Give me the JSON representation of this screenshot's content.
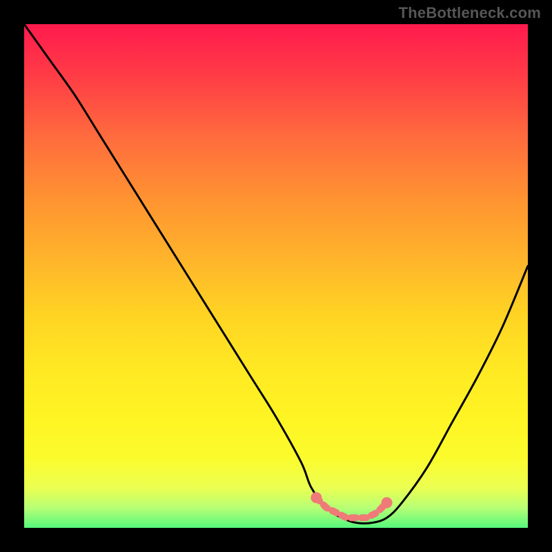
{
  "attribution": "TheBottleneck.com",
  "colors": {
    "background": "#000000",
    "attribution_text": "#565656",
    "curve": "#000000",
    "marker": "#ef7a78",
    "gradient_top": "#ff1a4d",
    "gradient_bottom": "#56f77c"
  },
  "chart_data": {
    "type": "line",
    "title": "",
    "xlabel": "",
    "ylabel": "",
    "xlim": [
      0,
      100
    ],
    "ylim": [
      0,
      100
    ],
    "x": [
      0,
      5,
      10,
      15,
      20,
      25,
      30,
      35,
      40,
      45,
      50,
      55,
      57,
      60,
      63,
      66,
      69,
      72,
      75,
      80,
      85,
      90,
      95,
      100
    ],
    "series": [
      {
        "name": "bottleneck-curve",
        "values": [
          100,
          93,
          86,
          78,
          70,
          62,
          54,
          46,
          38,
          30,
          22,
          13,
          8,
          4,
          2,
          1,
          1,
          2,
          5,
          12,
          21,
          30,
          40,
          52
        ]
      }
    ],
    "markers": {
      "name": "optimal-range",
      "x": [
        58,
        60,
        62,
        64,
        66,
        68,
        70,
        72
      ],
      "y": [
        6,
        4,
        3,
        2,
        2,
        2,
        3,
        5
      ]
    }
  }
}
